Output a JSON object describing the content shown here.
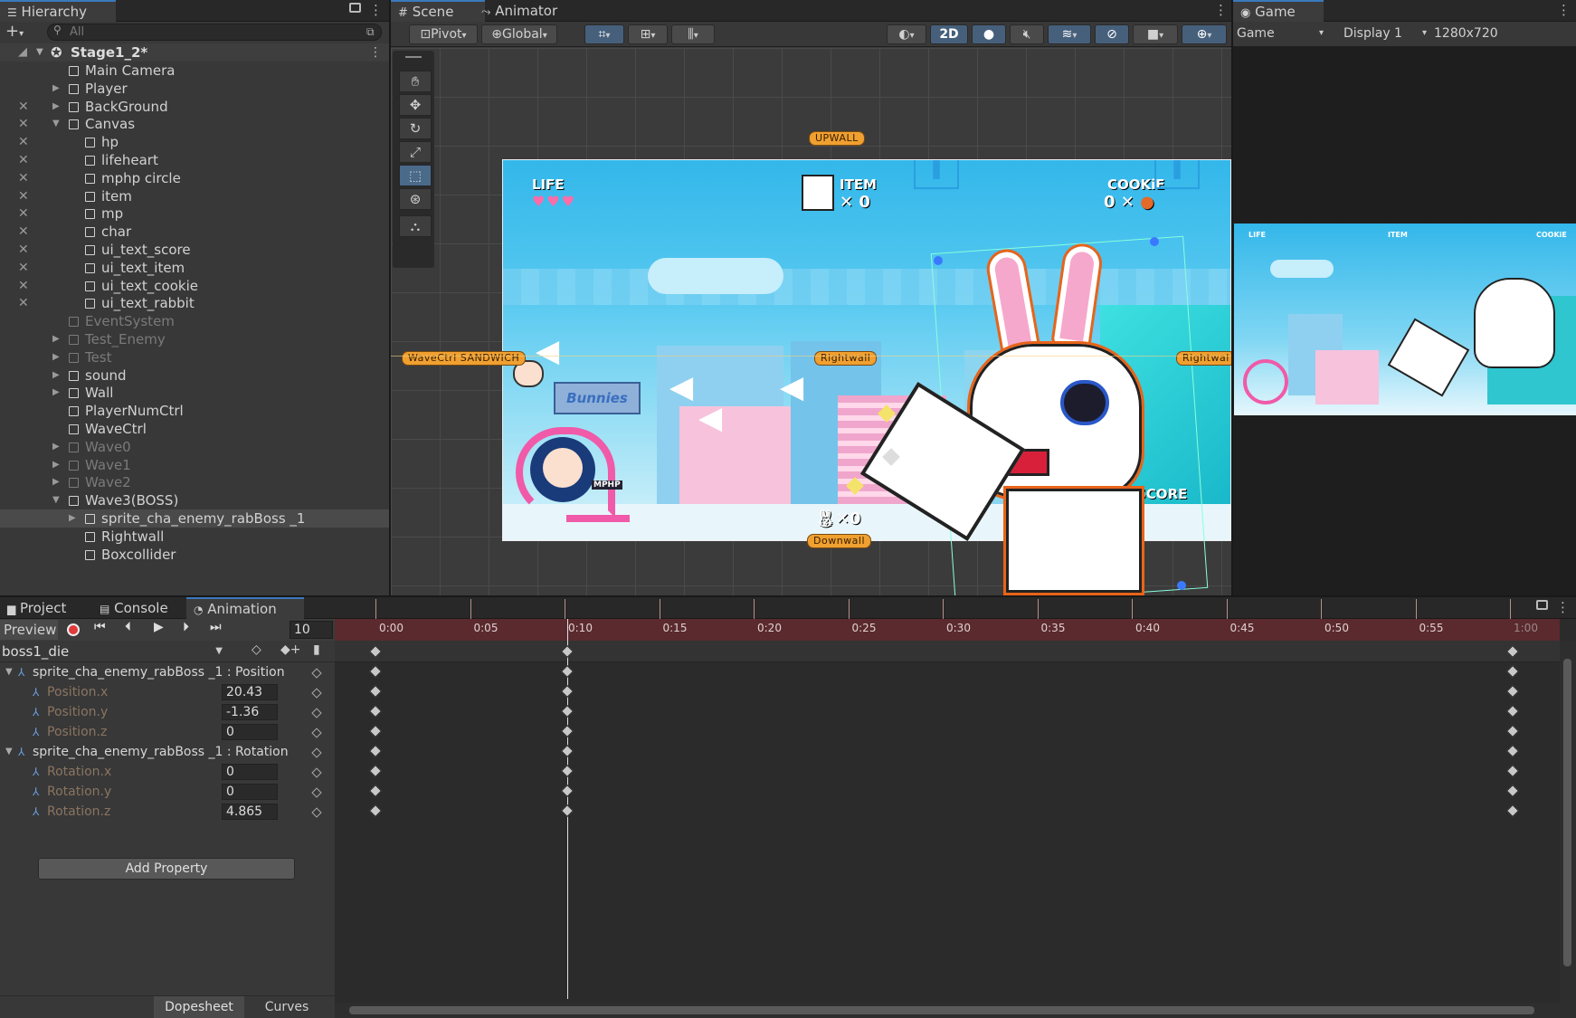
{
  "hierarchy": {
    "tab": "Hierarchy",
    "search_placeholder": "All",
    "scene_name": "Stage1_2*",
    "items": [
      {
        "label": "Main Camera",
        "depth": 1,
        "fold": "",
        "dim": false,
        "vis": false
      },
      {
        "label": "Player",
        "depth": 1,
        "fold": "right",
        "dim": false,
        "vis": false
      },
      {
        "label": "BackGround",
        "depth": 1,
        "fold": "right",
        "dim": false,
        "vis": true
      },
      {
        "label": "Canvas",
        "depth": 1,
        "fold": "down",
        "dim": false,
        "vis": true
      },
      {
        "label": "hp",
        "depth": 2,
        "fold": "",
        "dim": false,
        "vis": true
      },
      {
        "label": "lifeheart",
        "depth": 2,
        "fold": "",
        "dim": false,
        "vis": true
      },
      {
        "label": "mphp circle",
        "depth": 2,
        "fold": "",
        "dim": false,
        "vis": true
      },
      {
        "label": "item",
        "depth": 2,
        "fold": "",
        "dim": false,
        "vis": true
      },
      {
        "label": "mp",
        "depth": 2,
        "fold": "",
        "dim": false,
        "vis": true
      },
      {
        "label": "char",
        "depth": 2,
        "fold": "",
        "dim": false,
        "vis": true
      },
      {
        "label": "ui_text_score",
        "depth": 2,
        "fold": "",
        "dim": false,
        "vis": true
      },
      {
        "label": "ui_text_item",
        "depth": 2,
        "fold": "",
        "dim": false,
        "vis": true
      },
      {
        "label": "ui_text_cookie",
        "depth": 2,
        "fold": "",
        "dim": false,
        "vis": true
      },
      {
        "label": "ui_text_rabbit",
        "depth": 2,
        "fold": "",
        "dim": false,
        "vis": true
      },
      {
        "label": "EventSystem",
        "depth": 1,
        "fold": "",
        "dim": true,
        "vis": false
      },
      {
        "label": "Test_Enemy",
        "depth": 1,
        "fold": "right",
        "dim": true,
        "vis": false
      },
      {
        "label": "Test",
        "depth": 1,
        "fold": "right",
        "dim": true,
        "vis": false
      },
      {
        "label": "sound",
        "depth": 1,
        "fold": "right",
        "dim": false,
        "vis": false
      },
      {
        "label": "Wall",
        "depth": 1,
        "fold": "right",
        "dim": false,
        "vis": false
      },
      {
        "label": "PlayerNumCtrl",
        "depth": 1,
        "fold": "",
        "dim": false,
        "vis": false
      },
      {
        "label": "WaveCtrl",
        "depth": 1,
        "fold": "",
        "dim": false,
        "vis": false
      },
      {
        "label": "Wave0",
        "depth": 1,
        "fold": "right",
        "dim": true,
        "vis": false
      },
      {
        "label": "Wave1",
        "depth": 1,
        "fold": "right",
        "dim": true,
        "vis": false
      },
      {
        "label": "Wave2",
        "depth": 1,
        "fold": "right",
        "dim": true,
        "vis": false
      },
      {
        "label": "Wave3(BOSS)",
        "depth": 1,
        "fold": "down",
        "dim": false,
        "vis": false
      },
      {
        "label": "sprite_cha_enemy_rabBoss _1",
        "depth": 2,
        "fold": "right",
        "dim": false,
        "vis": false,
        "selected": true
      },
      {
        "label": "Rightwall",
        "depth": 2,
        "fold": "",
        "dim": false,
        "vis": false
      },
      {
        "label": "Boxcollider",
        "depth": 2,
        "fold": "",
        "dim": false,
        "vis": false
      }
    ]
  },
  "scene": {
    "tabs": [
      "Scene",
      "Animator"
    ],
    "pivot": "Pivot",
    "global": "Global",
    "mode_2d": "2D",
    "labels": {
      "upwall": "UPWALL",
      "wavectrl": "WaveCtrl SANDWICH",
      "rightwall_a": "Rightwall",
      "rightwall_b": "Rightwal",
      "downwall": "Downwall"
    },
    "hud": {
      "life": "LIFE",
      "item": "ITEM",
      "item_count": "0",
      "cookie": "COOKiE",
      "cookie_count": "0",
      "score": "SCORE",
      "rabbit_count": "0",
      "sign": "Bunnies",
      "mphp": "MPHP"
    }
  },
  "game": {
    "tab": "Game",
    "view": "Game",
    "display": "Display 1",
    "resolution": "1280x720"
  },
  "animation": {
    "tabs": [
      "Project",
      "Console",
      "Animation"
    ],
    "preview": "Preview",
    "frame": "10",
    "clip": "boss1_die",
    "timeline": [
      "0:00",
      "0:05",
      "0:10",
      "0:15",
      "0:20",
      "0:25",
      "0:30",
      "0:35",
      "0:40",
      "0:45",
      "0:50",
      "0:55",
      "1:00"
    ],
    "properties": [
      {
        "label": "sprite_cha_enemy_rabBoss _1 : Position",
        "group": true,
        "value": ""
      },
      {
        "label": "Position.x",
        "group": false,
        "value": "20.43"
      },
      {
        "label": "Position.y",
        "group": false,
        "value": "-1.36"
      },
      {
        "label": "Position.z",
        "group": false,
        "value": "0"
      },
      {
        "label": "sprite_cha_enemy_rabBoss _1 : Rotation",
        "group": true,
        "value": ""
      },
      {
        "label": "Rotation.x",
        "group": false,
        "value": "0"
      },
      {
        "label": "Rotation.y",
        "group": false,
        "value": "0"
      },
      {
        "label": "Rotation.z",
        "group": false,
        "value": "4.865"
      }
    ],
    "add_property": "Add Property",
    "dopesheet": "Dopesheet",
    "curves": "Curves"
  }
}
